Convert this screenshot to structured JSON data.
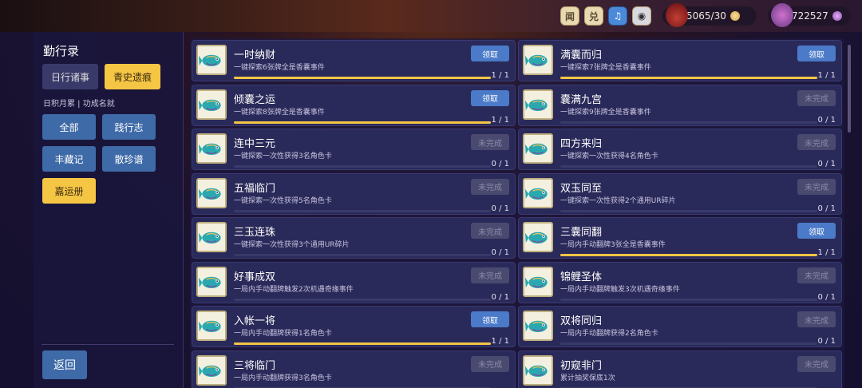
{
  "topbar": {
    "buttons": [
      {
        "label": "闻",
        "icon": "news-icon"
      },
      {
        "label": "兑",
        "icon": "exchange-icon"
      },
      {
        "label": "♫",
        "icon": "music-icon"
      },
      {
        "label": "◉",
        "icon": "eye-icon"
      }
    ],
    "stamina": "5065/30",
    "currency": "722527"
  },
  "sidebar": {
    "title": "勤行录",
    "tabs": [
      {
        "label": "日行诸事",
        "active": false
      },
      {
        "label": "青史遗痕",
        "active": true
      }
    ],
    "subtitle": "日积月累 | 功成名就",
    "categories": [
      {
        "label": "全部",
        "active": false
      },
      {
        "label": "践行志",
        "active": false
      },
      {
        "label": "丰藏记",
        "active": false
      },
      {
        "label": "散珍谱",
        "active": false
      },
      {
        "label": "嘉运册",
        "active": true
      }
    ],
    "back_label": "返回"
  },
  "achievements": [
    {
      "name": "一时纳财",
      "desc": "一键探索6张牌全是香囊事件",
      "button": "领取",
      "state": "claim",
      "progress": "1 / 1",
      "fill": 1
    },
    {
      "name": "满囊而归",
      "desc": "一键探索7张牌全是香囊事件",
      "button": "领取",
      "state": "claim",
      "progress": "1 / 1",
      "fill": 1
    },
    {
      "name": "倾囊之运",
      "desc": "一键探索8张牌全是香囊事件",
      "button": "领取",
      "state": "claim",
      "progress": "1 / 1",
      "fill": 1
    },
    {
      "name": "囊满九宫",
      "desc": "一键探索9张牌全是香囊事件",
      "button": "未完成",
      "state": "todo",
      "progress": "0 / 1",
      "fill": 0
    },
    {
      "name": "连中三元",
      "desc": "一键探索一次性获得3名角色卡",
      "button": "未完成",
      "state": "todo",
      "progress": "0 / 1",
      "fill": 0
    },
    {
      "name": "四方来归",
      "desc": "一键探索一次性获得4名角色卡",
      "button": "未完成",
      "state": "todo",
      "progress": "0 / 1",
      "fill": 0
    },
    {
      "name": "五福临门",
      "desc": "一键探索一次性获得5名角色卡",
      "button": "未完成",
      "state": "todo",
      "progress": "0 / 1",
      "fill": 0
    },
    {
      "name": "双玉同至",
      "desc": "一键探索一次性获得2个通用UR碎片",
      "button": "未完成",
      "state": "todo",
      "progress": "0 / 1",
      "fill": 0
    },
    {
      "name": "三玉连珠",
      "desc": "一键探索一次性获得3个通用UR碎片",
      "button": "未完成",
      "state": "todo",
      "progress": "0 / 1",
      "fill": 0
    },
    {
      "name": "三囊同翻",
      "desc": "一局内手动翻牌3张全是香囊事件",
      "button": "领取",
      "state": "claim",
      "progress": "1 / 1",
      "fill": 1
    },
    {
      "name": "好事成双",
      "desc": "一局内手动翻牌触发2次机遇奇缘事件",
      "button": "未完成",
      "state": "todo",
      "progress": "0 / 1",
      "fill": 0
    },
    {
      "name": "锦鲤圣体",
      "desc": "一局内手动翻牌触发3次机遇奇缘事件",
      "button": "未完成",
      "state": "todo",
      "progress": "0 / 1",
      "fill": 0
    },
    {
      "name": "入帐一将",
      "desc": "一局内手动翻牌获得1名角色卡",
      "button": "领取",
      "state": "claim",
      "progress": "1 / 1",
      "fill": 1
    },
    {
      "name": "双将同归",
      "desc": "一局内手动翻牌获得2名角色卡",
      "button": "未完成",
      "state": "todo",
      "progress": "0 / 1",
      "fill": 0
    },
    {
      "name": "三将临门",
      "desc": "一局内手动翻牌获得3名角色卡",
      "button": "未完成",
      "state": "todo",
      "progress": "",
      "fill": 0
    },
    {
      "name": "初窥非门",
      "desc": "累计抽奖保底1次",
      "button": "未完成",
      "state": "todo",
      "progress": "",
      "fill": 0
    }
  ]
}
